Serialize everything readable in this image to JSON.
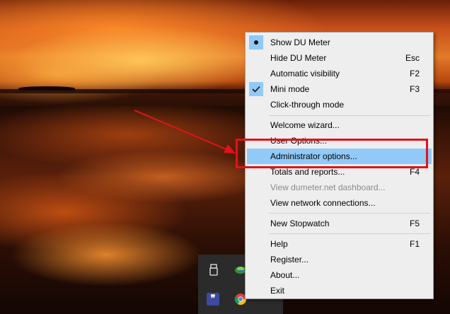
{
  "menu": {
    "items": [
      {
        "label": "Show DU Meter",
        "shortcut": "",
        "mark": "bullet",
        "disabled": false,
        "highlight": false
      },
      {
        "label": "Hide DU Meter",
        "shortcut": "Esc",
        "mark": "",
        "disabled": false,
        "highlight": false
      },
      {
        "label": "Automatic visibility",
        "shortcut": "F2",
        "mark": "",
        "disabled": false,
        "highlight": false
      },
      {
        "label": "Mini mode",
        "shortcut": "F3",
        "mark": "check",
        "disabled": false,
        "highlight": false
      },
      {
        "label": "Click-through mode",
        "shortcut": "",
        "mark": "",
        "disabled": false,
        "highlight": false
      },
      {
        "label": "Welcome wizard...",
        "shortcut": "",
        "mark": "",
        "disabled": false,
        "highlight": false
      },
      {
        "label": "User Options...",
        "shortcut": "",
        "mark": "",
        "disabled": false,
        "highlight": false
      },
      {
        "label": "Administrator options...",
        "shortcut": "",
        "mark": "",
        "disabled": false,
        "highlight": true
      },
      {
        "label": "Totals and reports...",
        "shortcut": "F4",
        "mark": "",
        "disabled": false,
        "highlight": false
      },
      {
        "label": "View dumeter.net dashboard...",
        "shortcut": "",
        "mark": "",
        "disabled": true,
        "highlight": false
      },
      {
        "label": "View network connections...",
        "shortcut": "",
        "mark": "",
        "disabled": false,
        "highlight": false
      },
      {
        "label": "New Stopwatch",
        "shortcut": "F5",
        "mark": "",
        "disabled": false,
        "highlight": false
      },
      {
        "label": "Help",
        "shortcut": "F1",
        "mark": "",
        "disabled": false,
        "highlight": false
      },
      {
        "label": "Register...",
        "shortcut": "",
        "mark": "",
        "disabled": false,
        "highlight": false
      },
      {
        "label": "About...",
        "shortcut": "",
        "mark": "",
        "disabled": false,
        "highlight": false
      },
      {
        "label": "Exit",
        "shortcut": "",
        "mark": "",
        "disabled": false,
        "highlight": false
      }
    ]
  },
  "tray": {
    "icons": [
      "usb-drive-icon",
      "network-icon",
      "quote-app-icon",
      "chrome-icon"
    ]
  },
  "colors": {
    "highlight": "#91c9f7",
    "annotation": "#e3121a",
    "menu_bg": "#eeeeee"
  }
}
